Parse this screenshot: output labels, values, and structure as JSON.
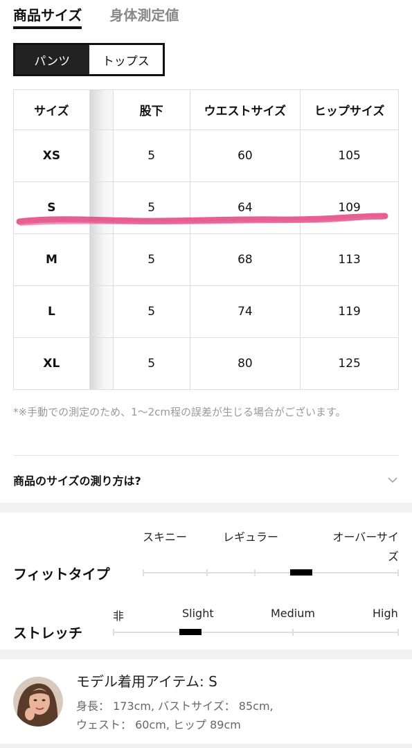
{
  "tabs": [
    {
      "label": "商品サイズ"
    },
    {
      "label": "身体測定値"
    }
  ],
  "segment": {
    "pants": "パンツ",
    "tops": "トップス"
  },
  "table": {
    "headers": [
      "サイズ",
      "",
      "股下",
      "ウエストサイズ",
      "ヒップサイズ"
    ],
    "rows": [
      [
        "XS",
        "",
        "5",
        "60",
        "105"
      ],
      [
        "S",
        "",
        "5",
        "64",
        "109"
      ],
      [
        "M",
        "",
        "5",
        "68",
        "113"
      ],
      [
        "L",
        "",
        "5",
        "74",
        "119"
      ],
      [
        "XL",
        "",
        "5",
        "80",
        "125"
      ]
    ]
  },
  "note": "*※手動での測定のため、1〜2cm程の誤差が生じる場合がございます。",
  "howto": {
    "label": "商品のサイズの測り方は?",
    "icon": "chevron-down-icon"
  },
  "fit": {
    "title": "フィットタイプ",
    "labels": [
      "スキニー",
      "レギュラー",
      "オーバーサイズ"
    ],
    "level": 0.62
  },
  "stretch": {
    "title": "ストレッチ",
    "labels": [
      "非",
      "Slight",
      "Medium",
      "High"
    ],
    "level": 0.27
  },
  "model": {
    "title": "モデル着用アイテム: S",
    "line1": "身長： 173cm, バストサイズ： 85cm,",
    "line2": "ウェスト： 60cm, ヒップ 89cm"
  },
  "colors": {
    "accent": "#111111",
    "highlight_stroke": "#e0437f"
  }
}
